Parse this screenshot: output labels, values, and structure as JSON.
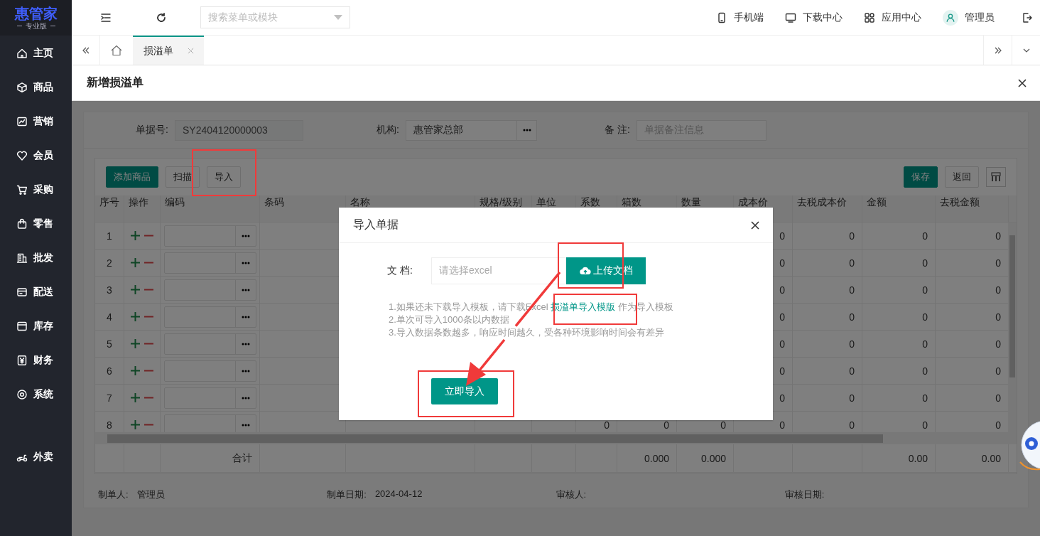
{
  "sidebar": {
    "logo": {
      "name": "惠管家",
      "edition": "专业版"
    },
    "items": [
      {
        "label": "主页"
      },
      {
        "label": "商品"
      },
      {
        "label": "营销"
      },
      {
        "label": "会员"
      },
      {
        "label": "采购"
      },
      {
        "label": "零售"
      },
      {
        "label": "批发"
      },
      {
        "label": "配送"
      },
      {
        "label": "库存"
      },
      {
        "label": "财务"
      },
      {
        "label": "系统"
      },
      {
        "label": "外卖",
        "kind": "apart"
      }
    ]
  },
  "topbar": {
    "search": {
      "placeholder": "搜索菜单或模块"
    },
    "links": [
      "手机端",
      "下载中心",
      "应用中心"
    ],
    "user": "管理员"
  },
  "tabs": [
    {
      "label": "损溢单",
      "selected": true
    }
  ],
  "page": {
    "title": "新增损溢单"
  },
  "form": {
    "fields": [
      {
        "label": "单据号:",
        "value": "SY2404120000003",
        "kind": "readonly"
      },
      {
        "label": "机构:",
        "value": "惠管家总部",
        "kind": "picker"
      },
      {
        "label": "备 注:",
        "placeholder": "单据备注信息",
        "kind": "text"
      }
    ]
  },
  "toolbar": {
    "left": [
      {
        "label": "添加商品",
        "kind": "primary"
      },
      {
        "label": "扫描",
        "kind": "plain"
      },
      {
        "label": "导入",
        "kind": "plain"
      }
    ],
    "right": [
      {
        "label": "保存",
        "kind": "primary"
      },
      {
        "label": "返回",
        "kind": "plain"
      }
    ]
  },
  "table": {
    "columns": [
      "序号",
      "操作",
      "编码",
      "条码",
      "名称",
      "规格/级别",
      "单位",
      "系数",
      "箱数",
      "数量",
      "成本价",
      "去税成本价",
      "金额",
      "去税金额"
    ],
    "rows": [
      {
        "no": "1",
        "values": {
          "cost": "0",
          "cost_ex_tax": "0",
          "amount": "0",
          "amount_ex_tax": "0"
        }
      },
      {
        "no": "2",
        "values": {
          "cost": "0",
          "cost_ex_tax": "0",
          "amount": "0",
          "amount_ex_tax": "0"
        }
      },
      {
        "no": "3",
        "values": {
          "cost": "0",
          "cost_ex_tax": "0",
          "amount": "0",
          "amount_ex_tax": "0"
        }
      },
      {
        "no": "4",
        "values": {
          "cost": "0",
          "cost_ex_tax": "0",
          "amount": "0",
          "amount_ex_tax": "0"
        }
      },
      {
        "no": "5",
        "values": {
          "cost": "0",
          "cost_ex_tax": "0",
          "amount": "0",
          "amount_ex_tax": "0"
        }
      },
      {
        "no": "6",
        "values": {
          "cost": "0",
          "cost_ex_tax": "0",
          "amount": "0",
          "amount_ex_tax": "0"
        }
      },
      {
        "no": "7",
        "values": {
          "cost": "0",
          "cost_ex_tax": "0",
          "amount": "0",
          "amount_ex_tax": "0"
        }
      },
      {
        "no": "8",
        "values": {
          "coef": "0",
          "boxes": "0",
          "qty": "0",
          "cost": "0",
          "cost_ex_tax": "0",
          "amount": "0",
          "amount_ex_tax": "0"
        }
      }
    ],
    "totals": {
      "label": "合计",
      "values": {
        "boxes": "0.000",
        "qty": "0.000",
        "amount": "0.00",
        "amount_ex_tax": "0.00"
      }
    }
  },
  "footer": [
    {
      "label": "制单人:",
      "value": "管理员"
    },
    {
      "label": "制单日期:",
      "value": "2024-04-12"
    },
    {
      "label": "审核人:"
    },
    {
      "label": "审核日期:"
    }
  ],
  "dialog": {
    "title": "导入单据",
    "file": {
      "label": "文 档:",
      "placeholder": "请选择excel"
    },
    "upload_button": "上传文档",
    "notes": [
      {
        "before": "1.如果还未下载导入模板，请下载Excel ",
        "link": "损溢单导入模版",
        "after": " 作为导入模板"
      },
      {
        "before": "2.单次可导入1000条以内数据"
      },
      {
        "before": "3.导入数据条数越多，响应时间越久，受各种环境影响时间会有差异"
      }
    ],
    "submit": "立即导入"
  }
}
